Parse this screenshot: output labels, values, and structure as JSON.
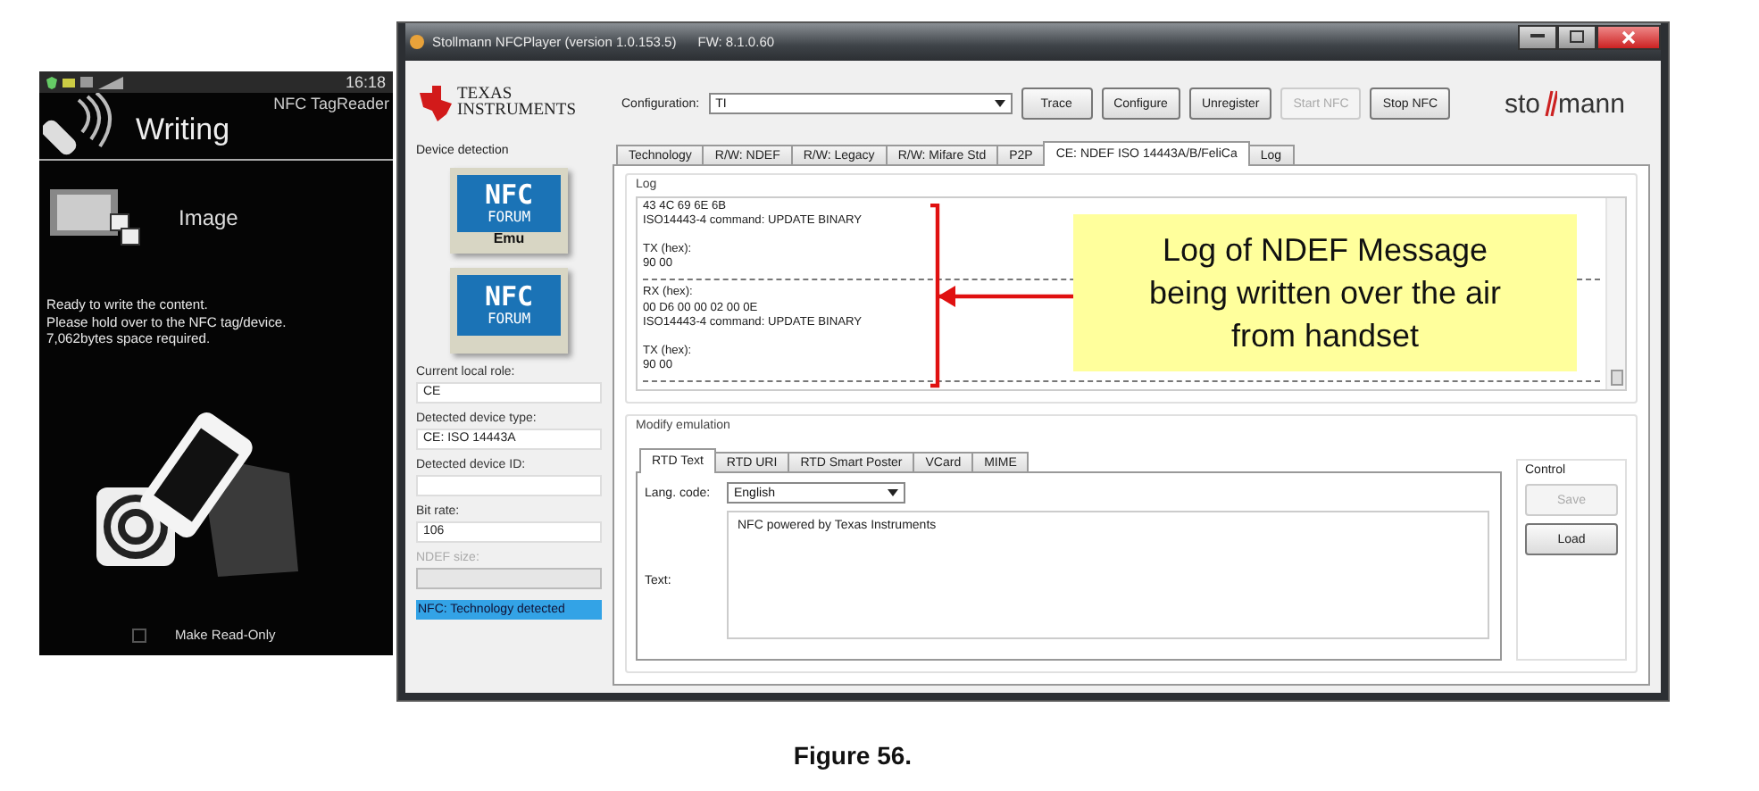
{
  "phone": {
    "status_time": "16:18",
    "app_name": "NFC TagReader",
    "title": "Writing",
    "content_type": "Image",
    "message": [
      "Ready to write the content.",
      "Please hold over to the NFC tag/device.",
      "7,062bytes space required."
    ],
    "read_only": {
      "label": "Make Read-Only",
      "checked": false
    }
  },
  "window": {
    "title": "Stollmann NFCPlayer (version 1.0.153.5)",
    "firmware": "FW: 8.1.0.60"
  },
  "ti_logo": [
    "TEXAS",
    "INSTRUMENTS"
  ],
  "configuration": {
    "label": "Configuration:",
    "value": "TI"
  },
  "toolbar": [
    {
      "label": "Trace",
      "disabled": false
    },
    {
      "label": "Configure",
      "disabled": false
    },
    {
      "label": "Unregister",
      "disabled": false
    },
    {
      "label": "Start NFC",
      "disabled": true
    },
    {
      "label": "Stop NFC",
      "disabled": false
    }
  ],
  "brand_logo": {
    "left": "sto",
    "right": "mann"
  },
  "device_detection": {
    "title": "Device detection",
    "logos": [
      {
        "top": "NFC",
        "bottom": "FORUM",
        "badge": "Emu"
      },
      {
        "top": "NFC",
        "bottom": "FORUM"
      }
    ],
    "fields": [
      {
        "label": "Current local role:",
        "value": "CE",
        "disabled": false
      },
      {
        "label": "Detected device type:",
        "value": "CE: ISO 14443A",
        "disabled": false
      },
      {
        "label": "Detected device ID:",
        "disabled": false
      },
      {
        "label": "Bit rate:",
        "value": "106",
        "disabled": false
      },
      {
        "label": "NDEF size:",
        "disabled": true
      }
    ],
    "status": "NFC: Technology detected"
  },
  "tabs": [
    {
      "label": "Technology",
      "selected": false
    },
    {
      "label": "R/W: NDEF",
      "selected": false
    },
    {
      "label": "R/W: Legacy",
      "selected": false
    },
    {
      "label": "R/W: Mifare Std",
      "selected": false
    },
    {
      "label": "P2P",
      "selected": false
    },
    {
      "label": "CE: NDEF ISO 14443A/B/FeliCa",
      "selected": true
    },
    {
      "label": "Log",
      "selected": false
    }
  ],
  "log": {
    "title": "Log",
    "lines": [
      {
        "kind": "text",
        "text": "43 4C 69 6E 6B"
      },
      {
        "kind": "text",
        "text": "ISO14443-4 command: UPDATE BINARY"
      },
      {
        "kind": "blank"
      },
      {
        "kind": "text",
        "text": "TX (hex):"
      },
      {
        "kind": "text",
        "text": "90 00"
      },
      {
        "kind": "separator"
      },
      {
        "kind": "text",
        "text": "RX (hex):"
      },
      {
        "kind": "text",
        "text": "00 D6 00 00 02 00 0E"
      },
      {
        "kind": "text",
        "text": "ISO14443-4 command: UPDATE BINARY"
      },
      {
        "kind": "blank"
      },
      {
        "kind": "text",
        "text": "TX (hex):"
      },
      {
        "kind": "text",
        "text": "90 00"
      },
      {
        "kind": "separator"
      }
    ]
  },
  "callout": [
    "Log of NDEF Message",
    "being written over the air",
    "from handset"
  ],
  "modify_emulation": {
    "title": "Modify emulation",
    "tabs": [
      {
        "label": "RTD Text",
        "selected": true
      },
      {
        "label": "RTD URI",
        "selected": false
      },
      {
        "label": "RTD Smart Poster",
        "selected": false
      },
      {
        "label": "VCard",
        "selected": false
      },
      {
        "label": "MIME",
        "selected": false
      }
    ],
    "lang_label": "Lang. code:",
    "lang_value": "English",
    "text_label": "Text:",
    "text_value": "NFC powered by Texas Instruments",
    "control": {
      "title": "Control",
      "buttons": [
        {
          "label": "Save",
          "disabled": true
        },
        {
          "label": "Load",
          "disabled": false
        }
      ]
    }
  },
  "caption": "Figure 56."
}
